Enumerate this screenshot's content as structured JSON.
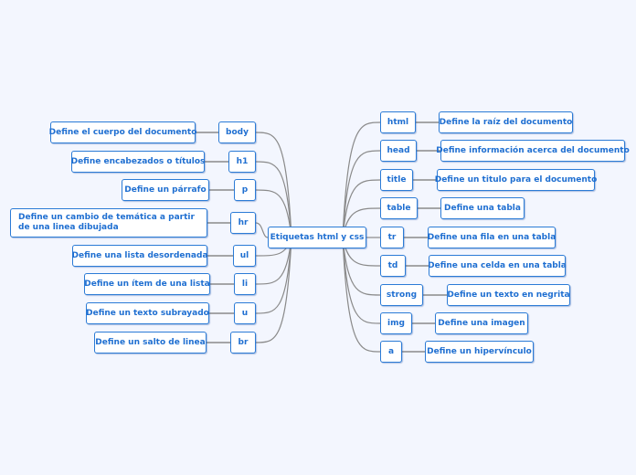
{
  "map": {
    "title": "Etiquetas html y css",
    "colors": {
      "background": "#f3f6fe",
      "node_border": "#2b7bd6",
      "node_text": "#1f6fd1",
      "node_fill": "#ffffff",
      "connector": "#8a8a8a"
    },
    "left_branches": [
      {
        "tag": "body",
        "description": "Define el cuerpo del documento"
      },
      {
        "tag": "h1",
        "description": "Define encabezados o títulos"
      },
      {
        "tag": "p",
        "description": "Define un párrafo"
      },
      {
        "tag": "hr",
        "description": "Define un cambio de temática a partir de una linea dibujada"
      },
      {
        "tag": "ul",
        "description": "Define una lista desordenada"
      },
      {
        "tag": "li",
        "description": "Define un ítem de una lista"
      },
      {
        "tag": "u",
        "description": "Define un texto subrayado"
      },
      {
        "tag": "br",
        "description": "Define un salto de linea"
      }
    ],
    "right_branches": [
      {
        "tag": "html",
        "description": "Define la raíz del documento"
      },
      {
        "tag": "head",
        "description": "Define información acerca del documento"
      },
      {
        "tag": "title",
        "description": "Define un titulo para el documento"
      },
      {
        "tag": "table",
        "description": "Define una tabla"
      },
      {
        "tag": "tr",
        "description": "Define una fila en una tabla"
      },
      {
        "tag": "td",
        "description": "Define una celda en una tabla"
      },
      {
        "tag": "strong",
        "description": "Define un texto en negrita"
      },
      {
        "tag": "img",
        "description": "Define una imagen"
      },
      {
        "tag": "a",
        "description": "Define un hipervínculo"
      }
    ]
  }
}
